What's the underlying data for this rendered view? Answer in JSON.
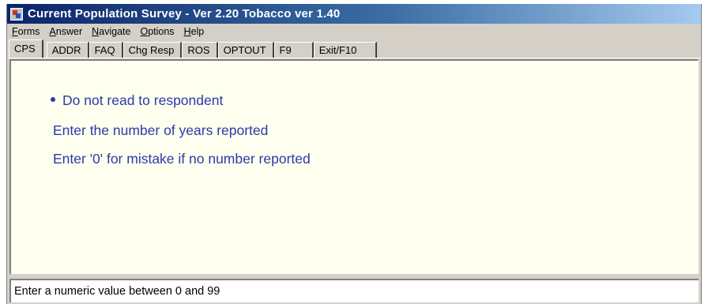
{
  "window": {
    "title": "Current Population Survey - Ver 2.20 Tobacco ver 1.40",
    "icon": "app-icon"
  },
  "menu": [
    {
      "mnemonic": "F",
      "rest": "orms"
    },
    {
      "mnemonic": "A",
      "rest": "nswer"
    },
    {
      "mnemonic": "N",
      "rest": "avigate"
    },
    {
      "mnemonic": "O",
      "rest": "ptions"
    },
    {
      "mnemonic": "H",
      "rest": "elp"
    }
  ],
  "tabs": [
    "CPS",
    "ADDR",
    "FAQ",
    "Chg Resp",
    "ROS",
    "OPTOUT",
    "F9",
    "Exit/F10"
  ],
  "active_tab": "CPS",
  "content": {
    "bullet_text": "Do not read to respondent",
    "line2": "Enter the number of years reported",
    "line3": "Enter '0' for mistake if no number reported"
  },
  "status": {
    "text": "Enter a numeric value between  0 and 99"
  },
  "colors": {
    "text_blue": "#2a3aa8",
    "content_bg": "#fffff0",
    "chrome": "#d4d0c8"
  }
}
